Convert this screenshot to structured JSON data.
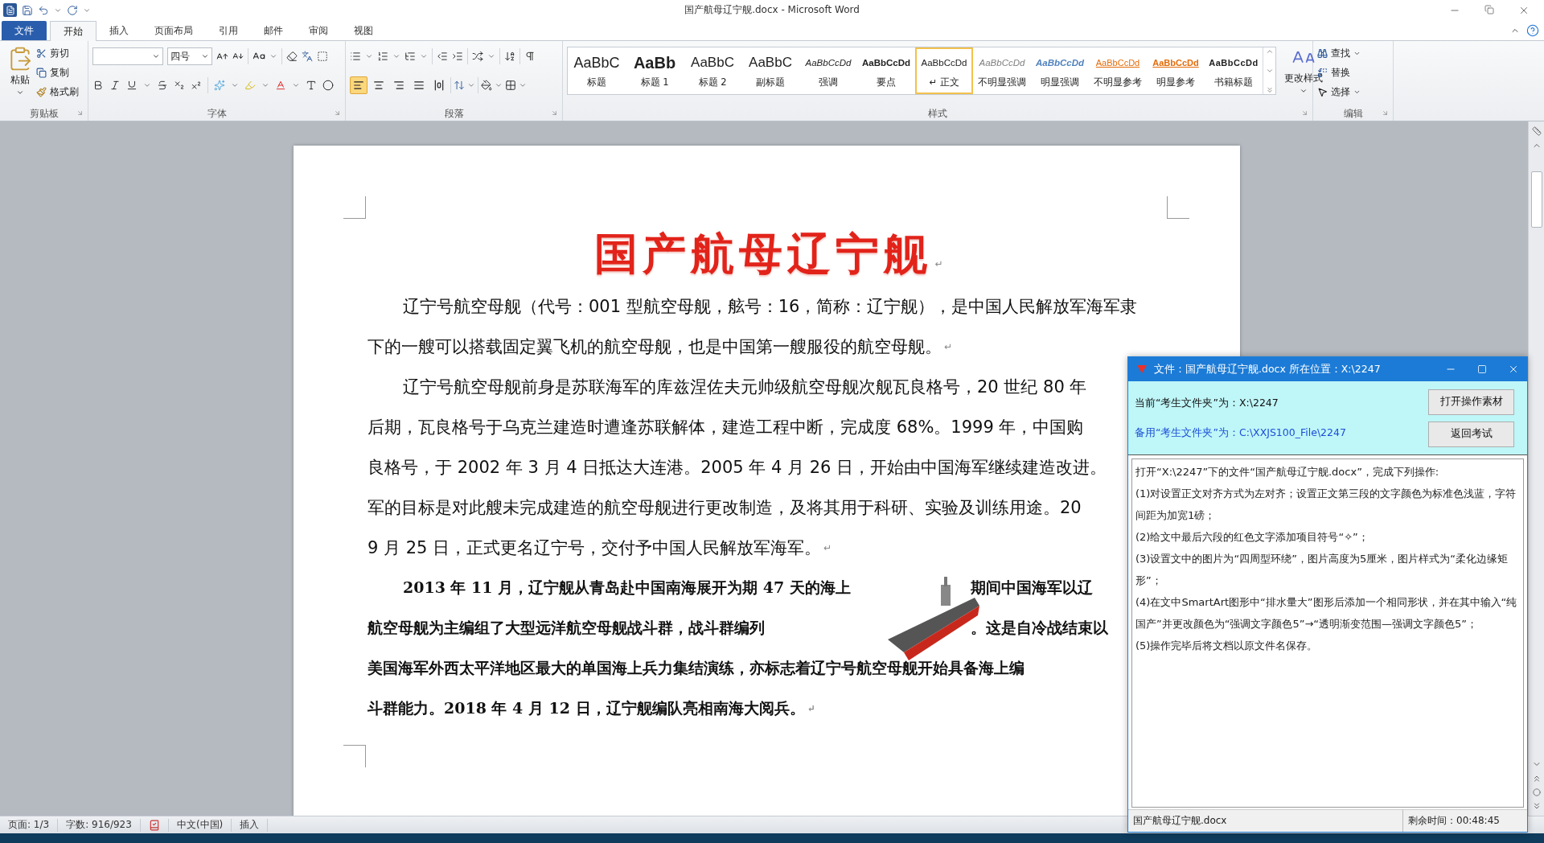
{
  "window": {
    "title": "国产航母辽宁舰.docx - Microsoft Word"
  },
  "ribbon_tabs": [
    {
      "label": "文件",
      "kind": "file",
      "selected": false
    },
    {
      "label": "开始",
      "kind": "tab",
      "selected": true
    },
    {
      "label": "插入",
      "kind": "tab",
      "selected": false
    },
    {
      "label": "页面布局",
      "kind": "tab",
      "selected": false
    },
    {
      "label": "引用",
      "kind": "tab",
      "selected": false
    },
    {
      "label": "邮件",
      "kind": "tab",
      "selected": false
    },
    {
      "label": "审阅",
      "kind": "tab",
      "selected": false
    },
    {
      "label": "视图",
      "kind": "tab",
      "selected": false
    }
  ],
  "clipboard": {
    "label": "剪贴板",
    "paste": "粘贴",
    "cut": "剪切",
    "copy": "复制",
    "format_painter": "格式刷"
  },
  "font": {
    "label": "字体",
    "size": "四号"
  },
  "paragraph": {
    "label": "段落",
    "alignment": [
      {
        "kind": "left",
        "selected": true
      },
      {
        "kind": "center",
        "selected": false
      },
      {
        "kind": "right",
        "selected": false
      },
      {
        "kind": "justify",
        "selected": false
      },
      {
        "kind": "distributed",
        "selected": false
      }
    ]
  },
  "styles": {
    "label": "样式",
    "change_styles": "更改样式",
    "items": [
      {
        "preview": "AaBbC",
        "name": "标题",
        "kind": "title",
        "selected": false
      },
      {
        "preview": "AaBb",
        "name": "标题 1",
        "kind": "heading1",
        "selected": false
      },
      {
        "preview": "AaBbC",
        "name": "标题 2",
        "kind": "heading2",
        "selected": false
      },
      {
        "preview": "AaBbC",
        "name": "副标题",
        "kind": "subtitle",
        "selected": false
      },
      {
        "preview": "AaBbCcDd",
        "name": "强调",
        "kind": "emphasis",
        "selected": false
      },
      {
        "preview": "AaBbCcDd",
        "name": "要点",
        "kind": "strong",
        "selected": false
      },
      {
        "preview": "AaBbCcDd",
        "name": "↵ 正文",
        "kind": "normal",
        "selected": true
      },
      {
        "preview": "AaBbCcDd",
        "name": "不明显强调",
        "kind": "subtle-emphasis",
        "selected": false
      },
      {
        "preview": "AaBbCcDd",
        "name": "明显强调",
        "kind": "intense-emphasis",
        "selected": false
      },
      {
        "preview": "AaBbCcDd",
        "name": "不明显参考",
        "kind": "subtle-reference",
        "selected": false
      },
      {
        "preview": "AaBbCcDd",
        "name": "明显参考",
        "kind": "intense-reference",
        "selected": false
      },
      {
        "preview": "AaBbCcDd",
        "name": "书籍标题",
        "kind": "book-title",
        "selected": false
      }
    ]
  },
  "editing": {
    "label": "编辑",
    "find": "查找",
    "replace": "替换",
    "select": "选择"
  },
  "document": {
    "title": "国产航母辽宁舰",
    "title_mark": "↵",
    "lines": [
      {
        "kind": "plain",
        "indent": true,
        "segments": [
          "辽宁号航空母舰（代号：001 型航空母舰，舷号：16，简称：辽宁舰），是中国人民解放军海军隶"
        ]
      },
      {
        "kind": "plain",
        "indent": false,
        "segments": [
          "下的一艘可以搭载固定翼飞机的航空母舰，也是中国第一艘服役的航空母舰。"
        ],
        "mark": "↵"
      },
      {
        "kind": "plain",
        "indent": true,
        "segments": [
          "辽宁号航空母舰前身是苏联海军的库兹涅佐夫元帅级航空母舰次舰瓦良格号，20 世纪 80 年"
        ]
      },
      {
        "kind": "plain",
        "indent": false,
        "segments": [
          "后期，瓦良格号于乌克兰建造时遭逢苏联解体，建造工程中断，完成度 68%。1999 年，中国购"
        ]
      },
      {
        "kind": "plain",
        "indent": false,
        "segments": [
          "良格号，于 2002 年 3 月 4 日抵达大连港。2005 年 4 月 26 日，开始由中国海军继续建造改进。"
        ]
      },
      {
        "kind": "plain",
        "indent": false,
        "segments": [
          "军的目标是对此艘未完成建造的航空母舰进行更改制造，及将其用于科研、实验及训练用途。20"
        ]
      },
      {
        "kind": "plain",
        "indent": false,
        "segments": [
          "9 月 25 日，正式更名辽宁号，交付予中国人民解放军海军。"
        ],
        "mark": "↵"
      },
      {
        "kind": "bold",
        "indent": true,
        "segments": [
          "2013 年 11 月，辽宁舰从青岛赴中国南海展开为期 47 天的海上",
          "期间中国海军以辽"
        ]
      },
      {
        "kind": "bold",
        "indent": false,
        "segments": [
          "航空母舰为主编组了大型远洋航空母舰战斗群，战斗群编列",
          "。这是自冷战结束以"
        ]
      },
      {
        "kind": "bold",
        "indent": false,
        "segments": [
          "美国海军外西太平洋地区最大的单国海上兵力集结演练，亦标志着辽宁号航空母舰开始具备海上编"
        ]
      },
      {
        "kind": "bold",
        "indent": false,
        "segments": [
          "斗群能力。2018 年 4 月 12 日，辽宁舰编队亮相南海大阅兵。"
        ],
        "mark": "↵"
      }
    ]
  },
  "exam_dialog": {
    "title": "文件：国产航母辽宁舰.docx 所在位置：X:\\2247",
    "current_folder": "当前“考生文件夹”为：X:\\2247",
    "backup_folder": "备用“考生文件夹”为：C:\\XXJS100_File\\2247",
    "buttons": [
      "打开操作素材",
      "返回考试"
    ],
    "instructions": [
      "打开“X:\\2247”下的文件“国产航母辽宁舰.docx”，完成下列操作:",
      "(1)对设置正文对齐方式为左对齐；设置正文第三段的文字颜色为标准色浅蓝，字符间距为加宽1磅；",
      "(2)给文中最后六段的红色文字添加项目符号“✧”；",
      "(3)设置文中的图片为“四周型环绕”，图片高度为5厘米，图片样式为“柔化边缘矩形”；",
      "(4)在文中SmartArt图形中“排水量大”图形后添加一个相同形状，并在其中输入“纯国产”并更改颜色为“强调文字颜色5”→“透明渐变范围—强调文字颜色5”；",
      "(5)操作完毕后将文档以原文件名保存。"
    ],
    "file_name": "国产航母辽宁舰.docx",
    "time_left": "剩余时间：00:48:45"
  },
  "status_bar": {
    "page": "页面: 1/3",
    "words": "字数: 916/923",
    "language": "中文(中国)",
    "mode": "插入"
  }
}
